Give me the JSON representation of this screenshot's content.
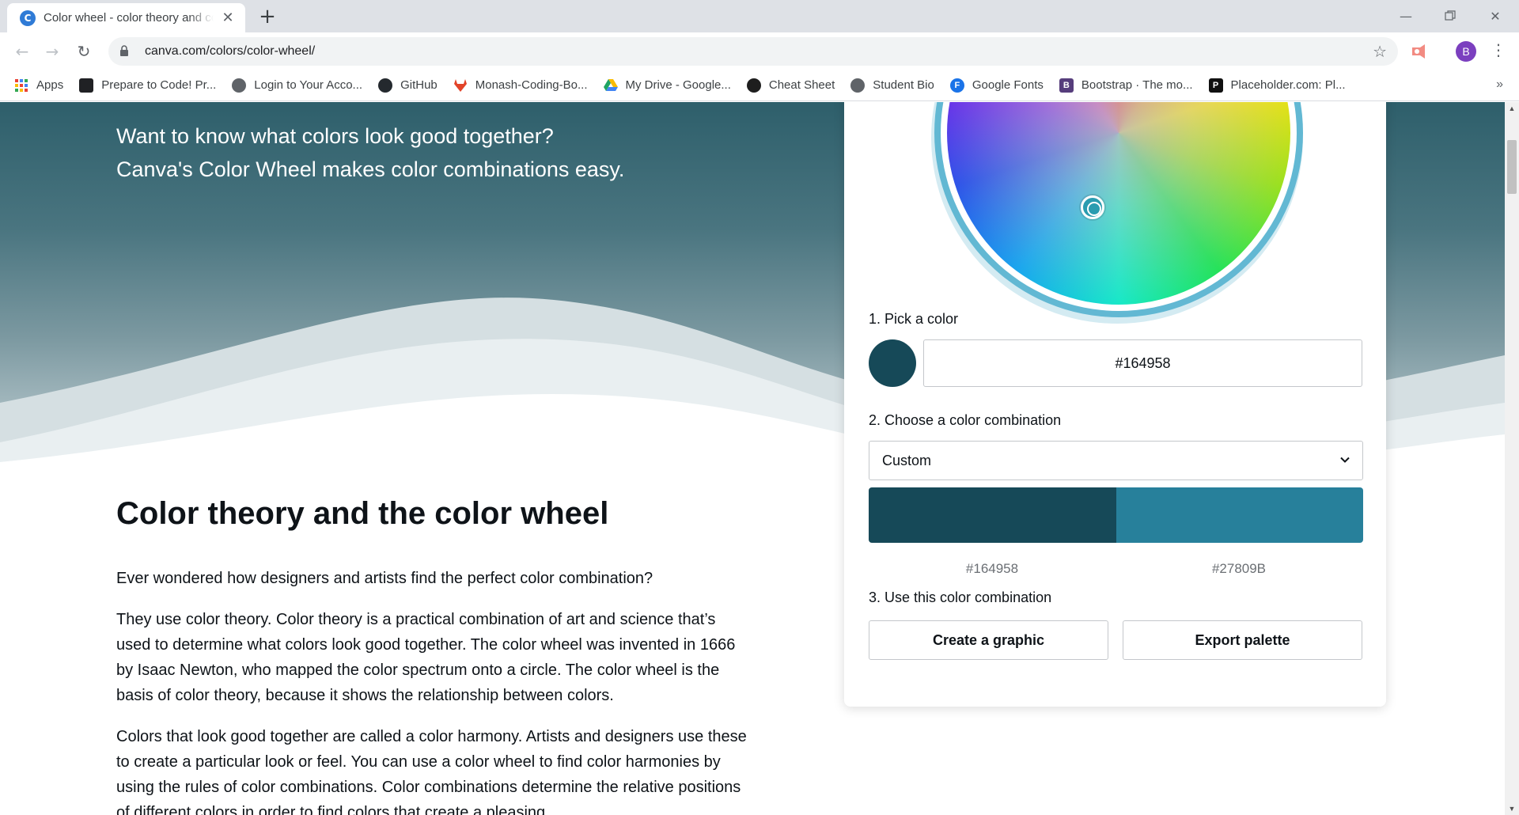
{
  "browser": {
    "tab_title": "Color wheel - color theory and color combinations",
    "tab_favicon_letter": "C",
    "new_tab_symbol": "+",
    "url": "canva.com/colors/color-wheel/",
    "profile_initial": "B",
    "bookmarks": [
      {
        "label": "Apps",
        "icon": "apps-grid-icon",
        "color": "#1a73e8"
      },
      {
        "label": "Prepare to Code! Pr...",
        "icon": "book-icon",
        "color": "#202124"
      },
      {
        "label": "Login to Your Acco...",
        "icon": "globe-icon",
        "color": "#5f6368"
      },
      {
        "label": "GitHub",
        "icon": "github-icon",
        "color": "#24292e"
      },
      {
        "label": "Monash-Coding-Bo...",
        "icon": "gitlab-icon",
        "color": "#e24329"
      },
      {
        "label": "My Drive - Google...",
        "icon": "drive-icon",
        "color": "#1fa463"
      },
      {
        "label": "Cheat Sheet",
        "icon": "cheat-sheet-icon",
        "color": "#1e1e1e"
      },
      {
        "label": "Student Bio",
        "icon": "globe-icon",
        "color": "#5f6368"
      },
      {
        "label": "Google Fonts",
        "icon": "google-fonts-icon",
        "color": "#1a73e8"
      },
      {
        "label": "Bootstrap · The mo...",
        "icon": "bootstrap-icon",
        "color": "#563d7c"
      },
      {
        "label": "Placeholder.com: Pl...",
        "icon": "placeholder-icon",
        "color": "#111111"
      }
    ],
    "bookmarks_overflow": "»"
  },
  "hero": {
    "line1": "Want to know what colors look good together?",
    "line2": "Canva's Color Wheel makes color combinations easy."
  },
  "article": {
    "heading": "Color theory and the color wheel",
    "paragraphs": [
      "Ever wondered how designers and artists find the perfect color combination?",
      "They use color theory. Color theory is a practical combination of art and science that’s used to determine what colors look good together. The color wheel was invented in 1666 by Isaac Newton, who mapped the color spectrum onto a circle. The color wheel is the basis of color theory, because it shows the relationship between colors.",
      "Colors that look good together are called a color harmony. Artists and designers use these to create a particular look or feel. You can use a color wheel to find color harmonies by using the rules of color combinations. Color combinations determine the relative positions of different colors in order to find colors that create a pleasing"
    ]
  },
  "tool": {
    "step1_label": "1. Pick a color",
    "picked_color": "#164958",
    "step2_label": "2. Choose a color combination",
    "combination": "Custom",
    "palette": [
      "#164958",
      "#27809B"
    ],
    "step3_label": "3. Use this color combination",
    "create_button": "Create a graphic",
    "export_button": "Export palette"
  }
}
